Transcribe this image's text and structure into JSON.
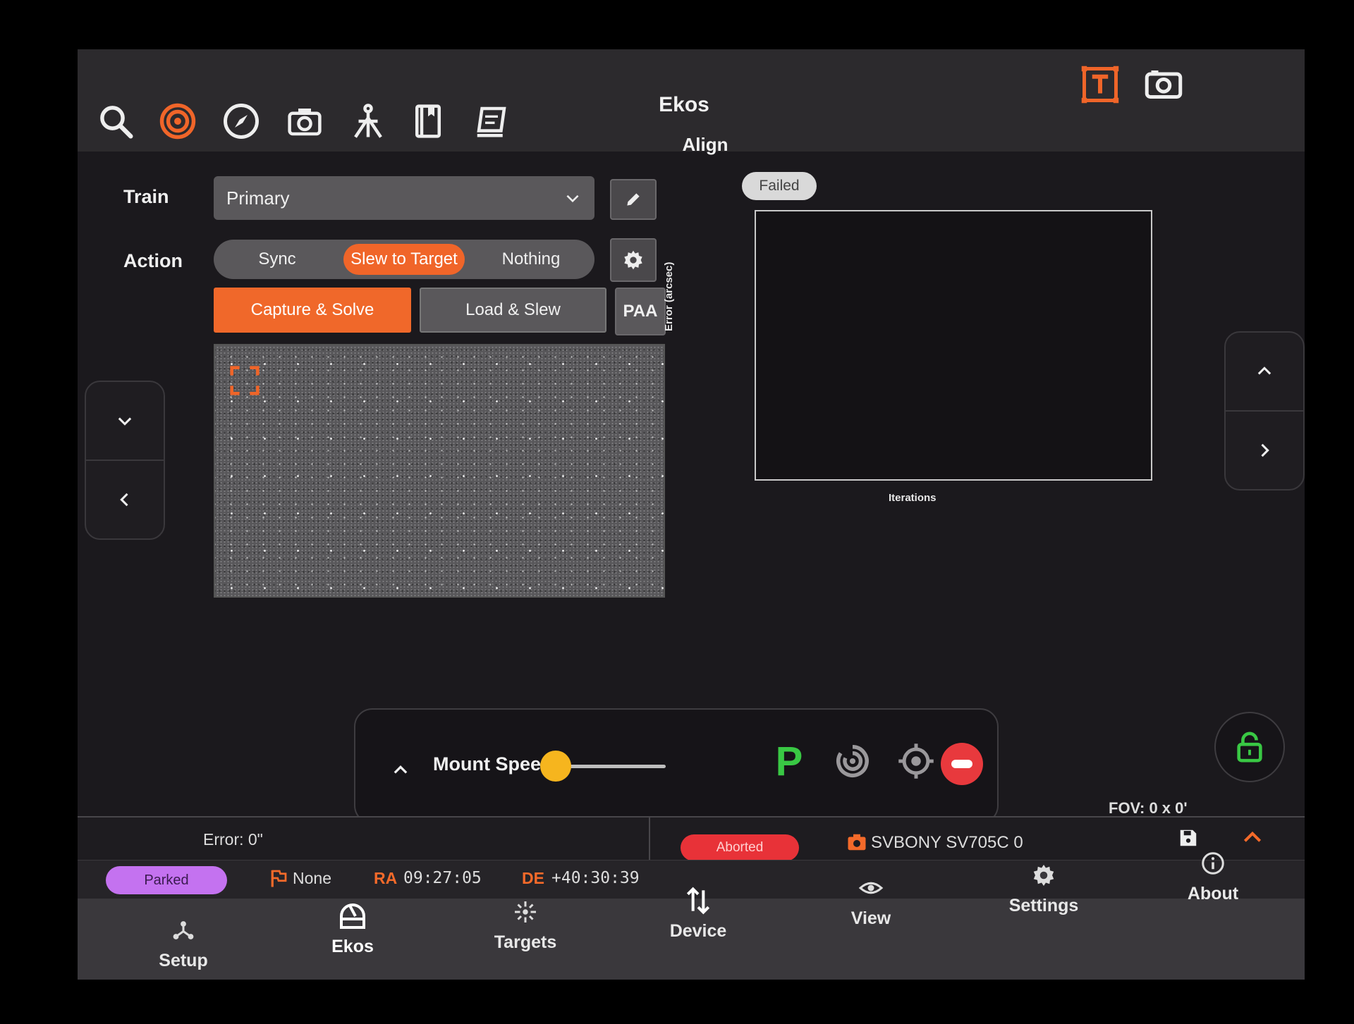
{
  "app": {
    "title": "Ekos",
    "module": "Align"
  },
  "toolbar": {
    "icons": [
      "search-icon",
      "align-target-icon",
      "compass-icon",
      "camera-icon",
      "tripod-icon",
      "book-icon",
      "scheduler-icon"
    ],
    "right_icons": [
      "text-frame-icon",
      "screenshot-icon"
    ]
  },
  "align": {
    "train_label": "Train",
    "train_value": "Primary",
    "action_label": "Action",
    "actions": [
      "Sync",
      "Slew to Target",
      "Nothing"
    ],
    "active_action": "Slew to Target",
    "capture_solve_label": "Capture & Solve",
    "load_slew_label": "Load & Slew",
    "paa_label": "PAA"
  },
  "plot": {
    "status": "Failed",
    "y_axis": "Error (arcsec)",
    "x_axis": "Iterations"
  },
  "mount": {
    "label": "Mount Speed",
    "speed": 0.0,
    "park_label": "P"
  },
  "status": {
    "error": "Error: 0\"",
    "fov": "FOV: 0 x 0'",
    "camera": "SVBONY SV705C 0",
    "align_state": "Aborted",
    "mount_state": "Parked",
    "target": "None",
    "ra_label": "RA",
    "ra_value": "09:27:05",
    "de_label": "DE",
    "de_value": "+40:30:39"
  },
  "nav": [
    {
      "label": "Setup",
      "icon": "setup-icon"
    },
    {
      "label": "Ekos",
      "icon": "ekos-icon"
    },
    {
      "label": "Targets",
      "icon": "targets-icon"
    },
    {
      "label": "Device",
      "icon": "device-icon"
    },
    {
      "label": "View",
      "icon": "eye-icon"
    },
    {
      "label": "Settings",
      "icon": "gear-icon"
    },
    {
      "label": "About",
      "icon": "info-icon"
    }
  ],
  "colors": {
    "accent": "#f06529",
    "parked": "#c472f0",
    "aborted": "#e83238",
    "park_green": "#39c844",
    "slider_knob": "#f6b51e"
  }
}
